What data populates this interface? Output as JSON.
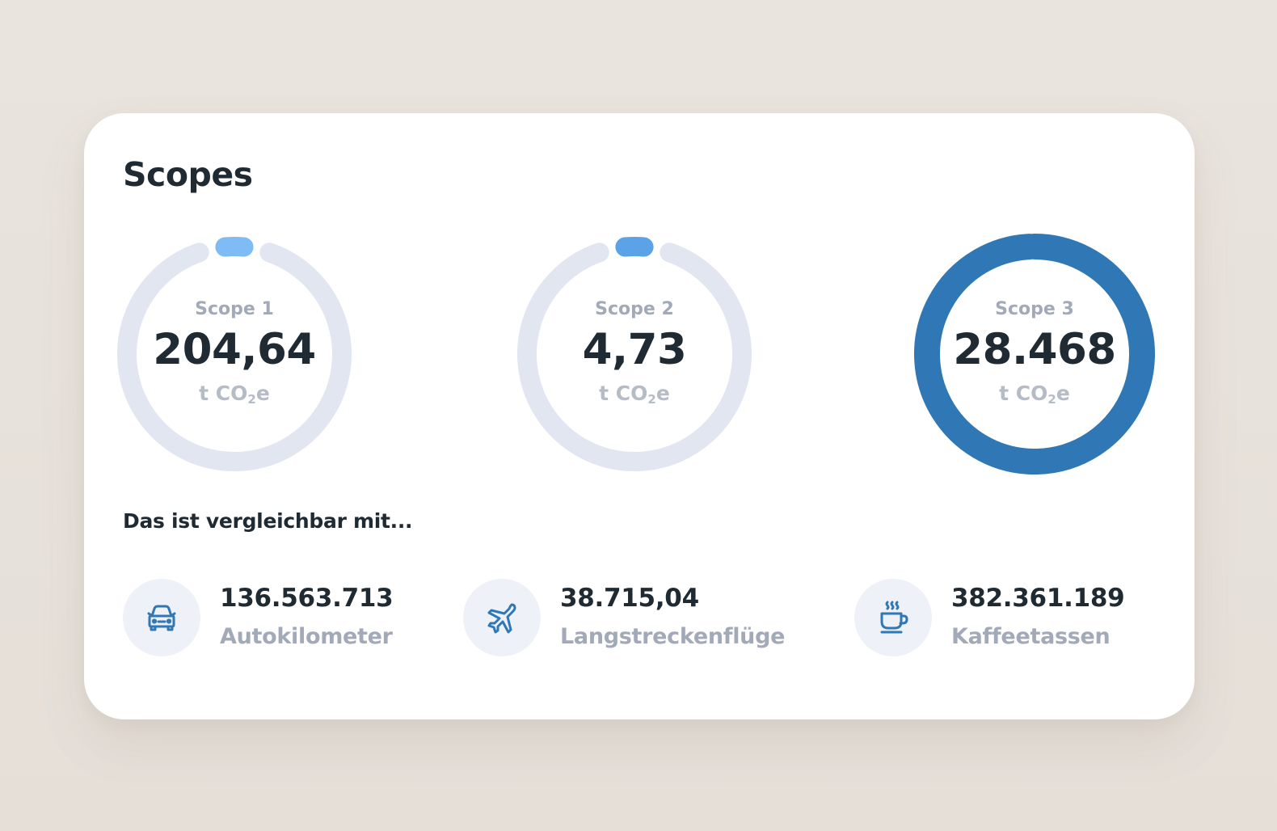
{
  "card": {
    "title": "Scopes",
    "unit_prefix": "t CO",
    "unit_sub": "2",
    "unit_suffix": "e"
  },
  "scopes": [
    {
      "label": "Scope 1",
      "value": "204,64",
      "share": 0.0071,
      "color": "#7fbcf5"
    },
    {
      "label": "Scope 2",
      "value": "4,73",
      "share": 0.0002,
      "color": "#5ba2e6"
    },
    {
      "label": "Scope 3",
      "value": "28.468",
      "share": 0.9927,
      "color": "#2f78b5"
    }
  ],
  "colors": {
    "track": "#e2e6f1",
    "icon_blue": "#2f78b5",
    "icon_bg": "#eef2f8"
  },
  "comparison": {
    "heading": "Das ist vergleichbar mit...",
    "items": [
      {
        "value": "136.563.713",
        "label": "Autokilometer",
        "icon": "car-icon"
      },
      {
        "value": "38.715,04",
        "label": "Langstreckenflüge",
        "icon": "airplane-icon"
      },
      {
        "value": "382.361.189",
        "label": "Kaffeetassen",
        "icon": "coffee-cup-icon"
      }
    ]
  }
}
